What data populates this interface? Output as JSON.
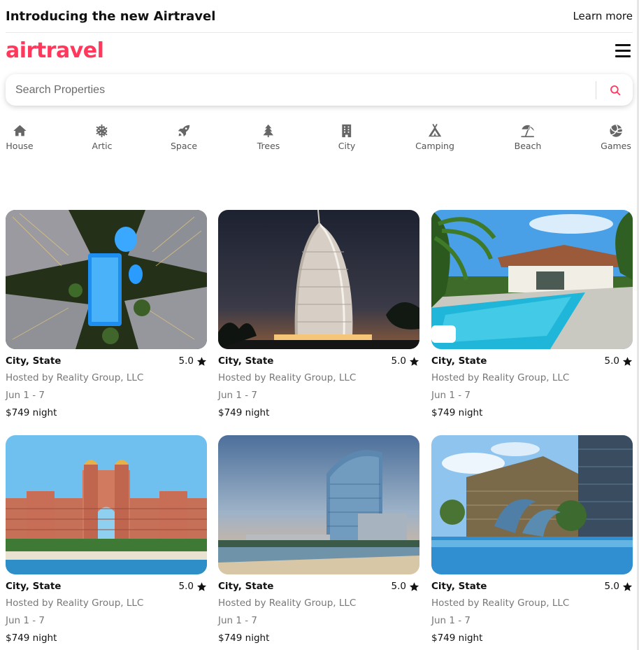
{
  "announcement": {
    "title": "Introducing the new Airtravel",
    "link": "Learn more"
  },
  "header": {
    "logo": "airtravel",
    "menu_icon": "hamburger-menu-icon"
  },
  "search": {
    "placeholder": "Search Properties",
    "icon": "search-icon"
  },
  "colors": {
    "brand": "#ff385c",
    "icon_gray": "#666666",
    "text": "#111111",
    "muted": "#777777"
  },
  "categories": [
    {
      "label": "House",
      "icon": "house-icon"
    },
    {
      "label": "Artic",
      "icon": "snowflake-icon"
    },
    {
      "label": "Space",
      "icon": "rocket-icon"
    },
    {
      "label": "Trees",
      "icon": "tree-icon"
    },
    {
      "label": "City",
      "icon": "building-icon"
    },
    {
      "label": "Camping",
      "icon": "tent-icon"
    },
    {
      "label": "Beach",
      "icon": "umbrella-beach-icon"
    },
    {
      "label": "Games",
      "icon": "volleyball-icon"
    }
  ],
  "listings": [
    {
      "location": "City, State",
      "rating": "5.0",
      "host": "Hosted by Reality Group, LLC",
      "dates": "Jun 1 - 7",
      "price": "$749 night",
      "image": "aerial-resort-pool-photo"
    },
    {
      "location": "City, State",
      "rating": "5.0",
      "host": "Hosted by Reality Group, LLC",
      "dates": "Jun 1 - 7",
      "price": "$749 night",
      "image": "sail-shaped-hotel-dusk-photo"
    },
    {
      "location": "City, State",
      "rating": "5.0",
      "host": "Hosted by Reality Group, LLC",
      "dates": "Jun 1 - 7",
      "price": "$749 night",
      "image": "tropical-villa-pool-photo"
    },
    {
      "location": "City, State",
      "rating": "5.0",
      "host": "Hosted by Reality Group, LLC",
      "dates": "Jun 1 - 7",
      "price": "$749 night",
      "image": "arched-palace-resort-photo"
    },
    {
      "location": "City, State",
      "rating": "5.0",
      "host": "Hosted by Reality Group, LLC",
      "dates": "Jun 1 - 7",
      "price": "$749 night",
      "image": "glass-tower-beach-photo"
    },
    {
      "location": "City, State",
      "rating": "5.0",
      "host": "Hosted by Reality Group, LLC",
      "dates": "Jun 1 - 7",
      "price": "$749 night",
      "image": "dolphin-fountain-city-photo"
    }
  ]
}
